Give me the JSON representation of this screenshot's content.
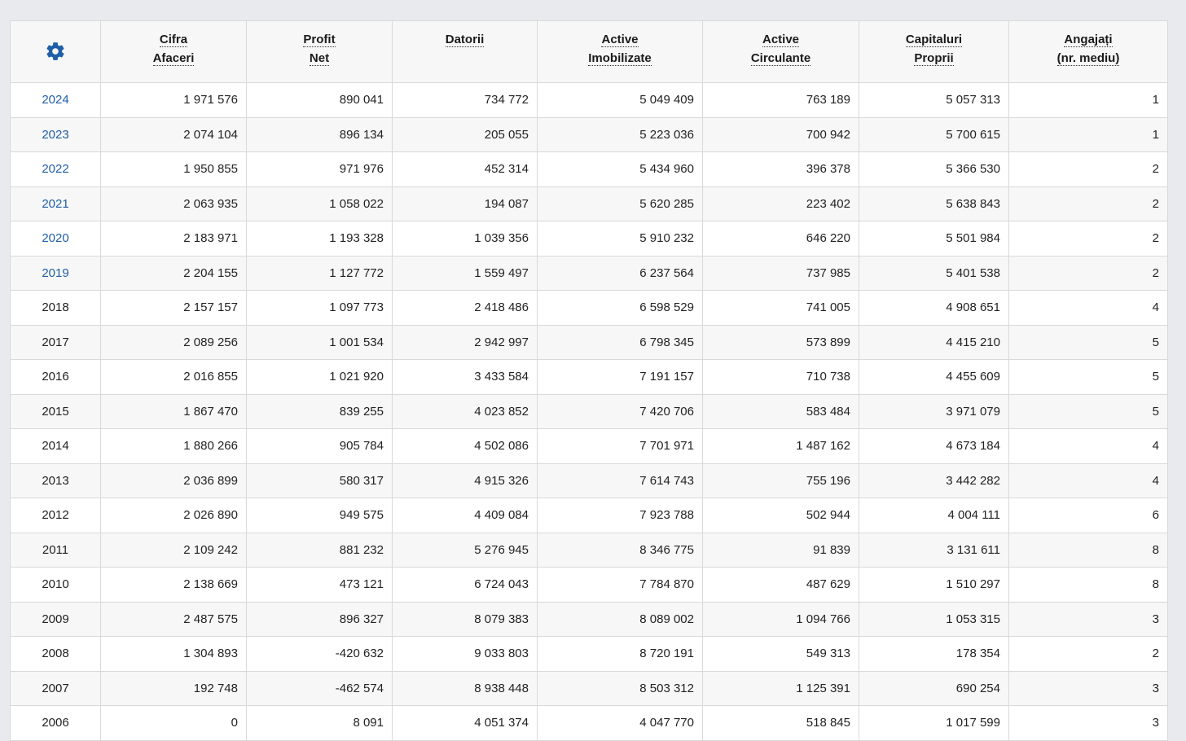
{
  "accent_color": "#1f5fa8",
  "header": {
    "settings_icon": "gear-icon",
    "columns": [
      {
        "line1": "Cifra",
        "line2": "Afaceri"
      },
      {
        "line1": "Profit",
        "line2": "Net"
      },
      {
        "line1": "Datorii",
        "line2": ""
      },
      {
        "line1": "Active",
        "line2": "Imobilizate"
      },
      {
        "line1": "Active",
        "line2": "Circulante"
      },
      {
        "line1": "Capitaluri",
        "line2": "Proprii"
      },
      {
        "line1": "Angajați",
        "line2": "(nr. mediu)"
      }
    ]
  },
  "rows": [
    {
      "year": "2024",
      "link": true,
      "cells": [
        "1 971 576",
        "890 041",
        "734 772",
        "5 049 409",
        "763 189",
        "5 057 313",
        "1"
      ]
    },
    {
      "year": "2023",
      "link": true,
      "cells": [
        "2 074 104",
        "896 134",
        "205 055",
        "5 223 036",
        "700 942",
        "5 700 615",
        "1"
      ]
    },
    {
      "year": "2022",
      "link": true,
      "cells": [
        "1 950 855",
        "971 976",
        "452 314",
        "5 434 960",
        "396 378",
        "5 366 530",
        "2"
      ]
    },
    {
      "year": "2021",
      "link": true,
      "cells": [
        "2 063 935",
        "1 058 022",
        "194 087",
        "5 620 285",
        "223 402",
        "5 638 843",
        "2"
      ]
    },
    {
      "year": "2020",
      "link": true,
      "cells": [
        "2 183 971",
        "1 193 328",
        "1 039 356",
        "5 910 232",
        "646 220",
        "5 501 984",
        "2"
      ]
    },
    {
      "year": "2019",
      "link": true,
      "cells": [
        "2 204 155",
        "1 127 772",
        "1 559 497",
        "6 237 564",
        "737 985",
        "5 401 538",
        "2"
      ]
    },
    {
      "year": "2018",
      "link": false,
      "cells": [
        "2 157 157",
        "1 097 773",
        "2 418 486",
        "6 598 529",
        "741 005",
        "4 908 651",
        "4"
      ]
    },
    {
      "year": "2017",
      "link": false,
      "cells": [
        "2 089 256",
        "1 001 534",
        "2 942 997",
        "6 798 345",
        "573 899",
        "4 415 210",
        "5"
      ]
    },
    {
      "year": "2016",
      "link": false,
      "cells": [
        "2 016 855",
        "1 021 920",
        "3 433 584",
        "7 191 157",
        "710 738",
        "4 455 609",
        "5"
      ]
    },
    {
      "year": "2015",
      "link": false,
      "cells": [
        "1 867 470",
        "839 255",
        "4 023 852",
        "7 420 706",
        "583 484",
        "3 971 079",
        "5"
      ]
    },
    {
      "year": "2014",
      "link": false,
      "cells": [
        "1 880 266",
        "905 784",
        "4 502 086",
        "7 701 971",
        "1 487 162",
        "4 673 184",
        "4"
      ]
    },
    {
      "year": "2013",
      "link": false,
      "cells": [
        "2 036 899",
        "580 317",
        "4 915 326",
        "7 614 743",
        "755 196",
        "3 442 282",
        "4"
      ]
    },
    {
      "year": "2012",
      "link": false,
      "cells": [
        "2 026 890",
        "949 575",
        "4 409 084",
        "7 923 788",
        "502 944",
        "4 004 111",
        "6"
      ]
    },
    {
      "year": "2011",
      "link": false,
      "cells": [
        "2 109 242",
        "881 232",
        "5 276 945",
        "8 346 775",
        "91 839",
        "3 131 611",
        "8"
      ]
    },
    {
      "year": "2010",
      "link": false,
      "cells": [
        "2 138 669",
        "473 121",
        "6 724 043",
        "7 784 870",
        "487 629",
        "1 510 297",
        "8"
      ]
    },
    {
      "year": "2009",
      "link": false,
      "cells": [
        "2 487 575",
        "896 327",
        "8 079 383",
        "8 089 002",
        "1 094 766",
        "1 053 315",
        "3"
      ]
    },
    {
      "year": "2008",
      "link": false,
      "cells": [
        "1 304 893",
        "-420 632",
        "9 033 803",
        "8 720 191",
        "549 313",
        "178 354",
        "2"
      ]
    },
    {
      "year": "2007",
      "link": false,
      "cells": [
        "192 748",
        "-462 574",
        "8 938 448",
        "8 503 312",
        "1 125 391",
        "690 254",
        "3"
      ]
    },
    {
      "year": "2006",
      "link": false,
      "cells": [
        "0",
        "8 091",
        "4 051 374",
        "4 047 770",
        "518 845",
        "1 017 599",
        "3"
      ]
    }
  ]
}
